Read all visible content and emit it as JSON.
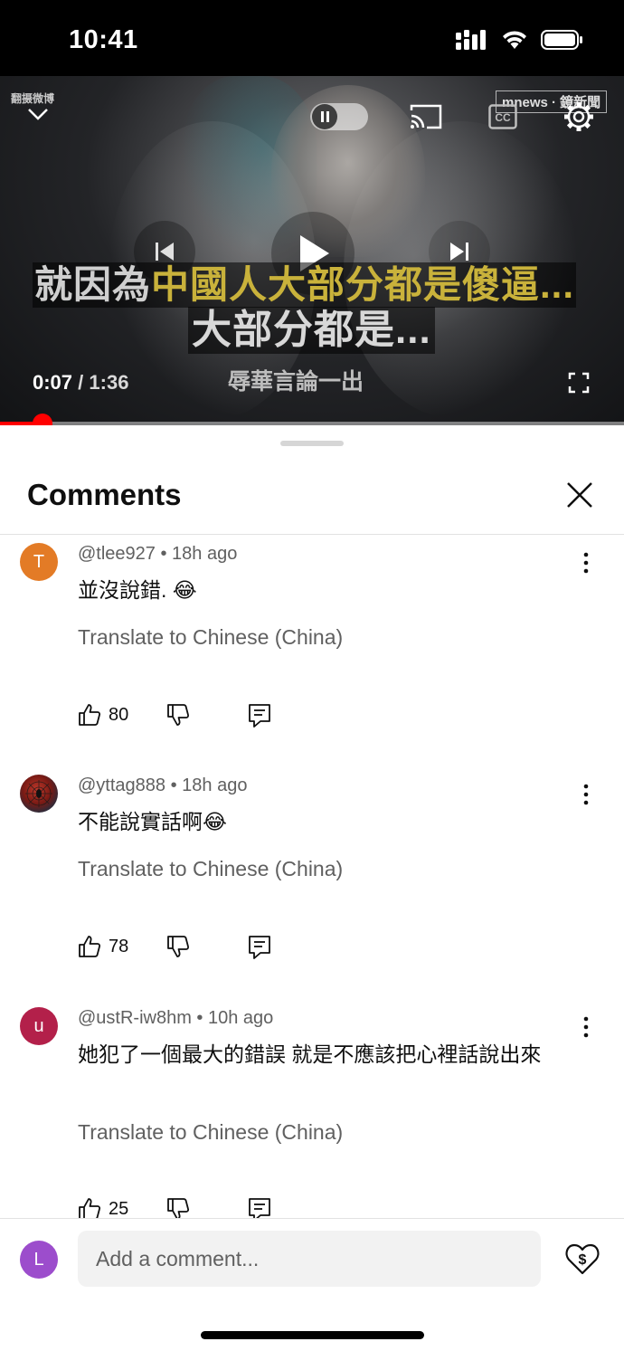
{
  "status_bar": {
    "time": "10:41",
    "icons": [
      "cellular-signal-icon",
      "wifi-icon",
      "battery-icon"
    ]
  },
  "video": {
    "watermark_left": "翻摄微博",
    "watermark_right": "mnews · 鏡新聞",
    "caption_line1_prefix": "就因為",
    "caption_line1_highlight": "中國人大部分都是傻逼...",
    "caption_line2": "大部分都是...",
    "caption_line3": "辱華言論一出",
    "current_time": "0:07",
    "time_separator": " / ",
    "duration": "1:36",
    "progress_fraction": 0.068,
    "icons": [
      "chevron-down-icon",
      "pause-icon",
      "cast-icon",
      "cc-icon",
      "settings-gear-icon",
      "previous-icon",
      "play-icon",
      "next-icon",
      "fullscreen-icon"
    ],
    "colors": {
      "progress": "#ff0000",
      "caption_highlight": "#c9b23b"
    }
  },
  "comments_panel": {
    "title": "Comments",
    "comments": [
      {
        "avatar_letter": "T",
        "avatar_color": "#e37b26",
        "meta": "@tlee927 • 18h ago",
        "text": "並沒說錯. 😂",
        "translate_label": "Translate to Chinese (China)",
        "likes": "80"
      },
      {
        "avatar_letter": "",
        "avatar_color": "#7a1a14",
        "meta": "@yttag888 • 18h ago",
        "text": "不能說實話啊😂",
        "translate_label": "Translate to Chinese (China)",
        "likes": "78"
      },
      {
        "avatar_letter": "u",
        "avatar_color": "#b3204a",
        "meta": "@ustR-iw8hm • 10h ago",
        "text": "她犯了一個最大的錯誤 就是不應該把心裡話說出來",
        "translate_label": "Translate to Chinese (China)",
        "likes": "25"
      }
    ]
  },
  "composer": {
    "avatar_letter": "L",
    "avatar_color": "#9c4dcc",
    "placeholder": "Add a comment...",
    "thanks_icon": "super-thanks-heart-dollar-icon"
  }
}
